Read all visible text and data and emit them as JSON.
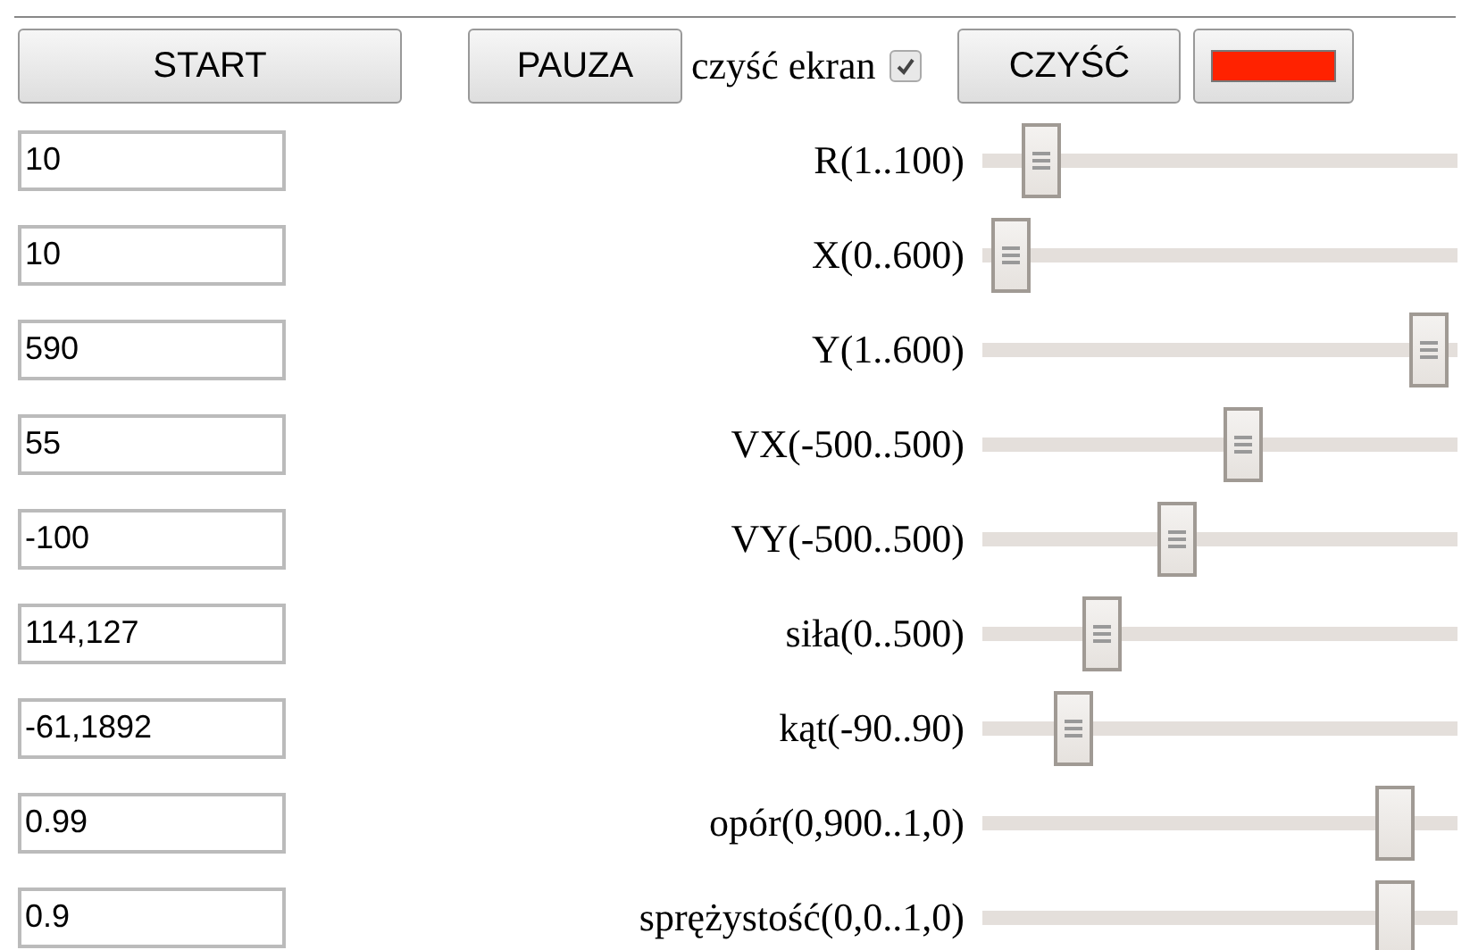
{
  "toolbar": {
    "start_button": "START",
    "pause_button": "PAUZA",
    "clear_screen": {
      "label": "czyść ekran",
      "checked": true
    },
    "clear_button": "CZYŚĆ",
    "color": "#ff2200"
  },
  "params": [
    {
      "value": "10",
      "label": "R(1..100)",
      "level": 0.09,
      "grip": true
    },
    {
      "value": "10",
      "label": "X(0..600)",
      "level": 0.02,
      "grip": true
    },
    {
      "value": "590",
      "label": "Y(1..600)",
      "level": 0.98,
      "grip": true
    },
    {
      "value": "55",
      "label": "VX(-500..500)",
      "level": 0.555,
      "grip": true
    },
    {
      "value": "-100",
      "label": "VY(-500..500)",
      "level": 0.4,
      "grip": true
    },
    {
      "value": "114,127",
      "label": "siła(0..500)",
      "level": 0.23,
      "grip": true
    },
    {
      "value": "-61,1892",
      "label": "kąt(-90..90)",
      "level": 0.165,
      "grip": true
    },
    {
      "value": "0.99",
      "label": "opór(0,900..1,0)",
      "level": 0.9,
      "grip": false
    },
    {
      "value": "0.9",
      "label": "sprężystość(0,0..1,0)",
      "level": 0.9,
      "grip": false
    }
  ]
}
